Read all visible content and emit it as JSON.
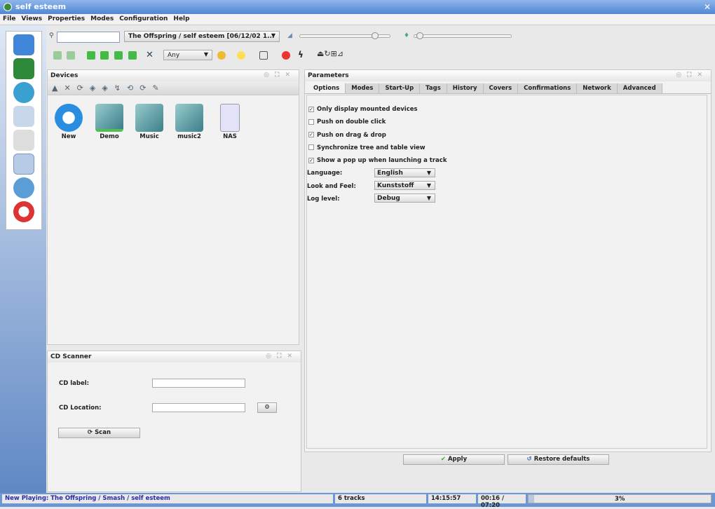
{
  "window": {
    "title": "self esteem"
  },
  "menu": [
    "File",
    "Views",
    "Properties",
    "Modes",
    "Configuration",
    "Help"
  ],
  "sidebar": {
    "icons": [
      "cube-blue-icon",
      "cube-green-icon",
      "play-disc-icon",
      "slideshow-icon",
      "document-icon",
      "config-tools-icon",
      "database-icon",
      "help-lifebuoy-icon"
    ],
    "active_index": 5
  },
  "toolbar": {
    "search_value": "",
    "track_combo": "The Offspring / self esteem [06/12/02 1...",
    "ambience_combo": "Any",
    "volume_percent": 85,
    "position_percent": 2
  },
  "devices": {
    "title": "Devices",
    "items": [
      {
        "label": "New",
        "icon": "gear-icon"
      },
      {
        "label": "Demo",
        "icon": "folder-mounted-icon"
      },
      {
        "label": "Music",
        "icon": "folder-icon"
      },
      {
        "label": "music2",
        "icon": "folder-icon"
      },
      {
        "label": "NAS",
        "icon": "nas-icon"
      }
    ]
  },
  "cd_scanner": {
    "title": "CD Scanner",
    "label_label": "CD label:",
    "label_value": "",
    "location_label": "CD Location:",
    "location_value": "",
    "scan_label": "Scan"
  },
  "parameters": {
    "title": "Parameters",
    "tabs": [
      "Options",
      "Modes",
      "Start-Up",
      "Tags",
      "History",
      "Covers",
      "Confirmations",
      "Network",
      "Advanced"
    ],
    "active_tab": "Options",
    "checkboxes": [
      {
        "label": "Only display mounted devices",
        "checked": true
      },
      {
        "label": "Push on double click",
        "checked": false
      },
      {
        "label": "Push on drag & drop",
        "checked": true
      },
      {
        "label": "Synchronize tree and table view",
        "checked": false
      },
      {
        "label": "Show a pop up when launching a track",
        "checked": true
      }
    ],
    "language_label": "Language:",
    "language_value": "English",
    "laf_label": "Look and Feel:",
    "laf_value": "Kunststoff",
    "log_label": "Log level:",
    "log_value": "Debug",
    "apply_label": "Apply",
    "restore_label": "Restore defaults"
  },
  "status": {
    "now_playing": "New Playing:  The Offspring / Smash / self esteem",
    "tracks": "6 tracks",
    "clock": "14:15:57",
    "time": "00:16 / 07:20",
    "progress_label": "3%",
    "progress_percent": 3
  }
}
